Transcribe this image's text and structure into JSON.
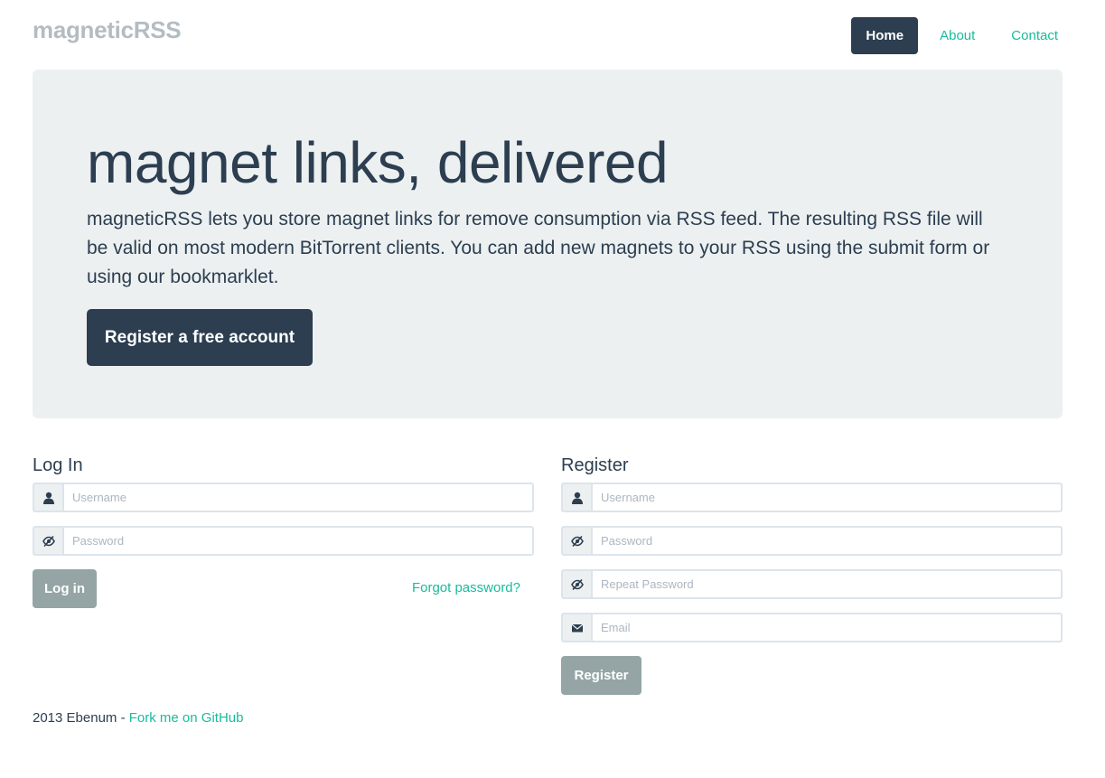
{
  "header": {
    "brand": "magneticRSS",
    "nav": [
      {
        "label": "Home",
        "active": true
      },
      {
        "label": "About",
        "active": false
      },
      {
        "label": "Contact",
        "active": false
      }
    ]
  },
  "hero": {
    "title": "magnet links, delivered",
    "description": "magneticRSS lets you store magnet links for remove consumption via RSS feed. The resulting RSS file will be valid on most modern BitTorrent clients. You can add new magnets to your RSS using the submit form or using our bookmarklet.",
    "cta_label": "Register a free account"
  },
  "login": {
    "heading": "Log In",
    "username_placeholder": "Username",
    "password_placeholder": "Password",
    "submit_label": "Log in",
    "forgot_label": "Forgot password?"
  },
  "register": {
    "heading": "Register",
    "username_placeholder": "Username",
    "password_placeholder": "Password",
    "repeat_password_placeholder": "Repeat Password",
    "email_placeholder": "Email",
    "submit_label": "Register"
  },
  "footer": {
    "copyright": "2013 Ebenum - ",
    "link_label": "Fork me on GitHub"
  },
  "icons": {
    "user": "user-icon",
    "password": "eye-slash-icon",
    "email": "envelope-icon"
  },
  "colors": {
    "primary": "#2c3e50",
    "accent": "#18bc9c",
    "muted": "#95a5a6",
    "brand": "#b4bcc2",
    "jumbotron": "#ecf0f1"
  }
}
